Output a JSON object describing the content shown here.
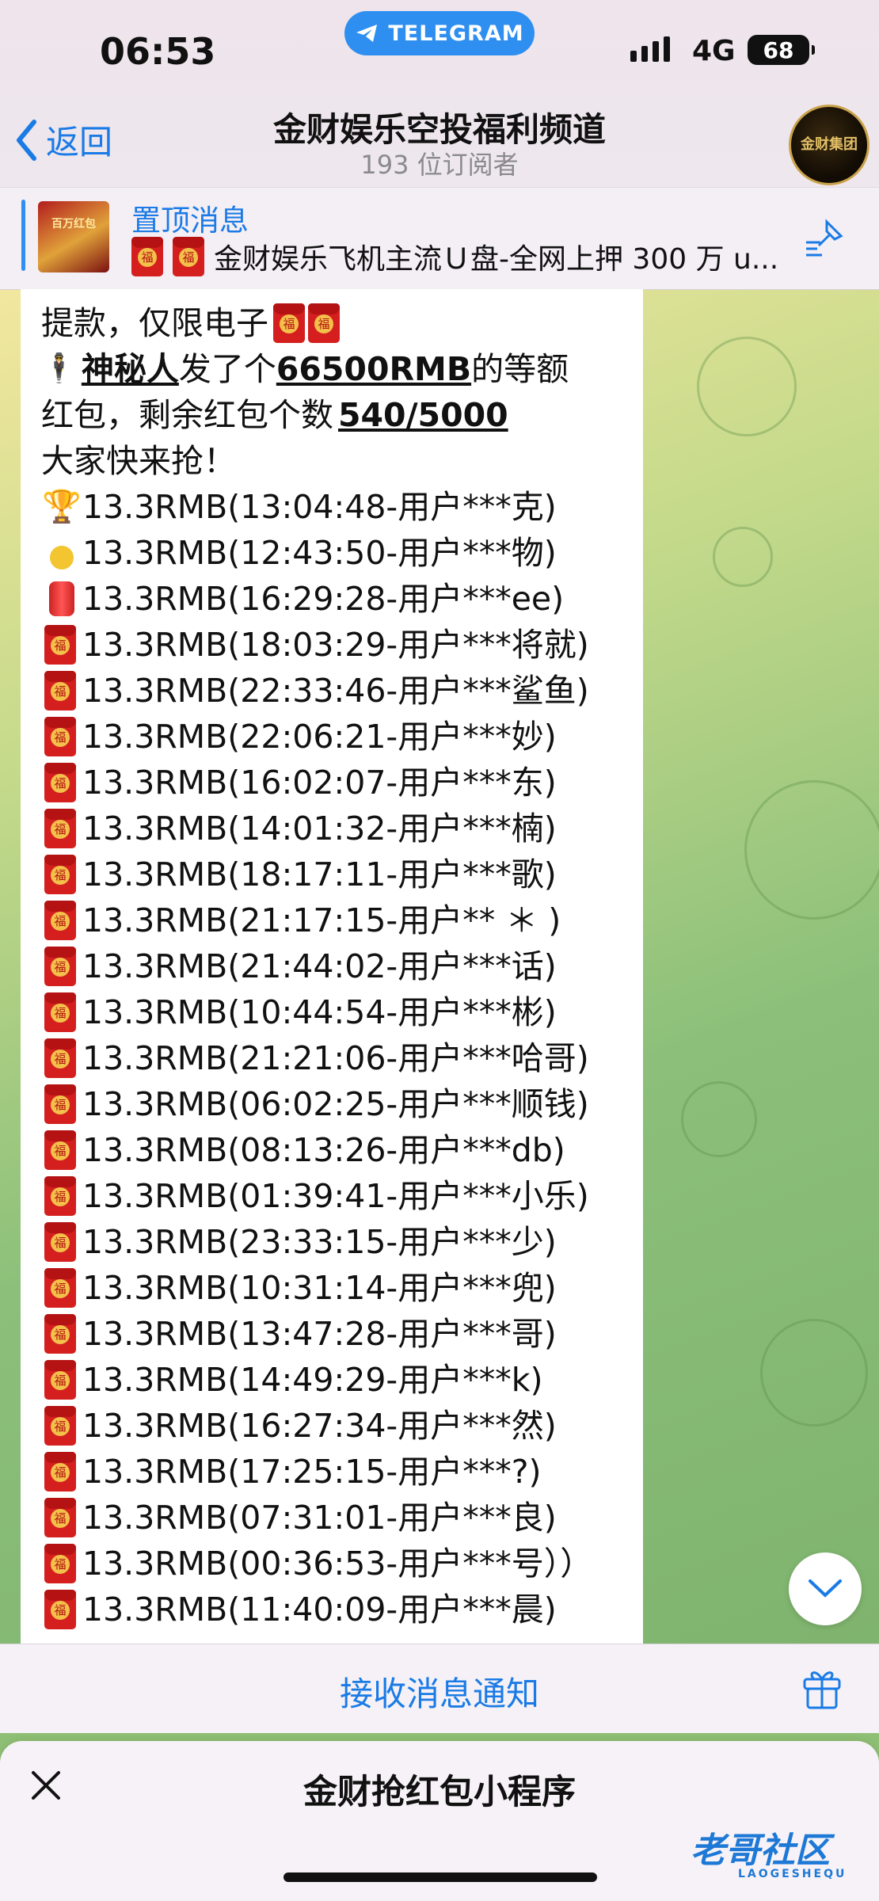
{
  "status_bar": {
    "time": "06:53",
    "app_pill": "TELEGRAM",
    "network": "4G",
    "battery": "68"
  },
  "header": {
    "back_label": "返回",
    "title": "金财娱乐空投福利频道",
    "subtitle": "193 位订阅者",
    "avatar_text": "金财集团"
  },
  "pinned": {
    "label": "置顶消息",
    "text": "金财娱乐飞机主流Ｕ盘-全网上押 300 万 u...",
    "thumb_text": "百万红包"
  },
  "message": {
    "intro_line_top": "提款，仅限电子",
    "sender": "神秘人",
    "sent_text": "发了个",
    "amount": "66500RMB",
    "amount_suffix": "的等额",
    "line2_prefix": "红包，剩余红包个数",
    "remaining": "540/5000",
    "line3": "大家快来抢！",
    "entries": [
      {
        "icon": "trophy",
        "text": "13.3RMB(13:04:48-用户***克)"
      },
      {
        "icon": "medal",
        "text": "13.3RMB(12:43:50-用户***物)"
      },
      {
        "icon": "can",
        "text": "13.3RMB(16:29:28-用户***ee)"
      },
      {
        "icon": "red-packet",
        "text": "13.3RMB(18:03:29-用户***将就)"
      },
      {
        "icon": "red-packet",
        "text": "13.3RMB(22:33:46-用户***鲨鱼)"
      },
      {
        "icon": "red-packet",
        "text": "13.3RMB(22:06:21-用户***妙)"
      },
      {
        "icon": "red-packet",
        "text": "13.3RMB(16:02:07-用户***东)"
      },
      {
        "icon": "red-packet",
        "text": "13.3RMB(14:01:32-用户***楠)"
      },
      {
        "icon": "red-packet",
        "text": "13.3RMB(18:17:11-用户***歌)"
      },
      {
        "icon": "red-packet",
        "text": "13.3RMB(21:17:15-用户** ＊ )"
      },
      {
        "icon": "red-packet",
        "text": "13.3RMB(21:44:02-用户***话)"
      },
      {
        "icon": "red-packet",
        "text": "13.3RMB(10:44:54-用户***彬)"
      },
      {
        "icon": "red-packet",
        "text": "13.3RMB(21:21:06-用户***哈哥)"
      },
      {
        "icon": "red-packet",
        "text": "13.3RMB(06:02:25-用户***顺钱)"
      },
      {
        "icon": "red-packet",
        "text": "13.3RMB(08:13:26-用户***db)"
      },
      {
        "icon": "red-packet",
        "text": "13.3RMB(01:39:41-用户***小乐)"
      },
      {
        "icon": "red-packet",
        "text": "13.3RMB(23:33:15-用户***少)"
      },
      {
        "icon": "red-packet",
        "text": "13.3RMB(10:31:14-用户***兜)"
      },
      {
        "icon": "red-packet",
        "text": "13.3RMB(13:47:28-用户***哥)"
      },
      {
        "icon": "red-packet",
        "text": "13.3RMB(14:49:29-用户***k)"
      },
      {
        "icon": "red-packet",
        "text": "13.3RMB(16:27:34-用户***然)"
      },
      {
        "icon": "red-packet",
        "text": "13.3RMB(17:25:15-用户***?)"
      },
      {
        "icon": "red-packet",
        "text": "13.3RMB(07:31:01-用户***良)"
      },
      {
        "icon": "red-packet",
        "text": "13.3RMB(00:36:53-用户***号））"
      },
      {
        "icon": "red-packet",
        "text": "13.3RMB(11:40:09-用户***晨)"
      }
    ]
  },
  "bottom_bar": {
    "notify_label": "接收消息通知"
  },
  "mini_app": {
    "title": "金财抢红包小程序"
  },
  "watermark": {
    "text": "老哥社区",
    "sub": "LAOGESHEQU"
  },
  "colors": {
    "accent": "#1a7be6",
    "telegram_blue": "#2f8ff0",
    "red_packet": "#d51f1f"
  }
}
